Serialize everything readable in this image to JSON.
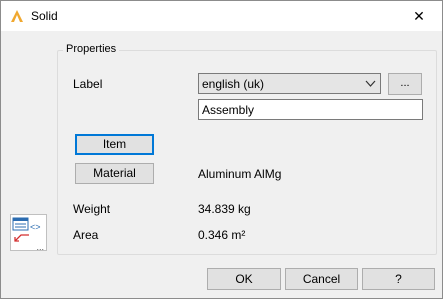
{
  "window": {
    "title": "Solid",
    "close_glyph": "✕"
  },
  "properties": {
    "group_title": "Properties",
    "label_caption": "Label",
    "language_selected": "english (uk)",
    "more_button_label": "...",
    "label_value": "Assembly",
    "item_button_label": "Item",
    "material_button_label": "Material",
    "material_value": "Aluminum AlMg",
    "weight_caption": "Weight",
    "weight_value": "34.839 kg",
    "area_caption": "Area",
    "area_value": "0.346 m²"
  },
  "side_icon": {
    "name": "component-link-icon",
    "dots": "..."
  },
  "footer": {
    "ok_label": "OK",
    "cancel_label": "Cancel",
    "help_label": "?"
  },
  "colors": {
    "accent": "#0078d7",
    "app_icon": "#f0a830",
    "link_arrow": "#d32f2f"
  }
}
